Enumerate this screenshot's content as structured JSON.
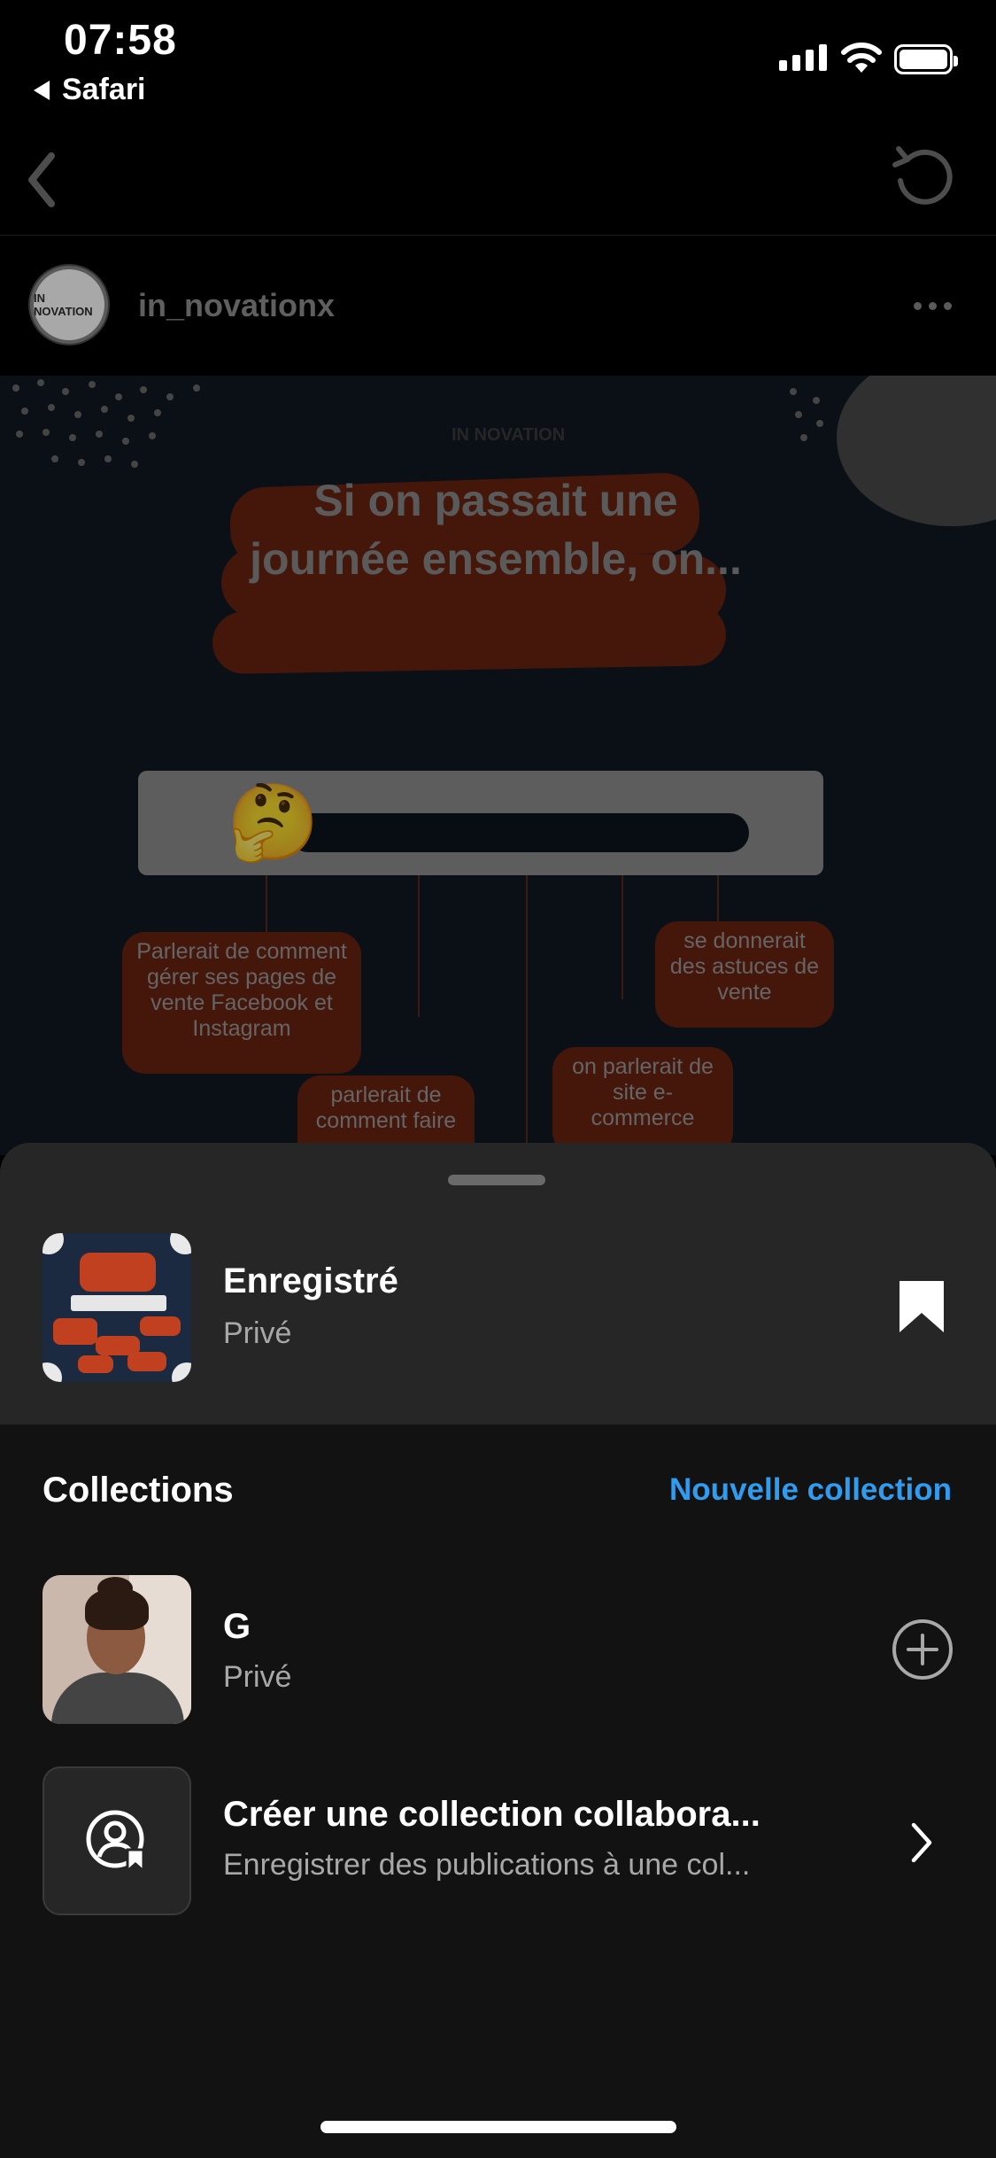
{
  "status_bar": {
    "time": "07:58",
    "back_app": "Safari"
  },
  "post": {
    "username": "in_novationx",
    "avatar_text": "IN NOVATION",
    "image_brand": "IN NOVATION",
    "image_headline": "Si on passait une journée ensemble, on...",
    "image_bubbles": [
      "Parlerait de comment gérer ses pages de vente Facebook et Instagram",
      "se donnerait des astuces de vente",
      "parlerait de comment faire",
      "on parlerait de site e-commerce"
    ]
  },
  "sheet": {
    "saved": {
      "title": "Enregistré",
      "subtitle": "Privé"
    },
    "collections_title": "Collections",
    "new_collection_label": "Nouvelle collection",
    "collections": [
      {
        "name": "G",
        "subtitle": "Privé"
      }
    ],
    "collab": {
      "title": "Créer une collection collabora...",
      "subtitle": "Enregistrer des publications à une col..."
    }
  },
  "icons": {
    "nav_back": "chevron-left-icon",
    "nav_refresh": "refresh-icon",
    "more": "more-dots-icon",
    "saved": "bookmark-icon",
    "add": "add-circle-icon",
    "collab": "collab-collection-icon",
    "forward": "chevron-right-icon"
  },
  "colors": {
    "accent": "#2f9cf0",
    "sheet_bg": "#121212",
    "sheet_top": "#262626"
  }
}
